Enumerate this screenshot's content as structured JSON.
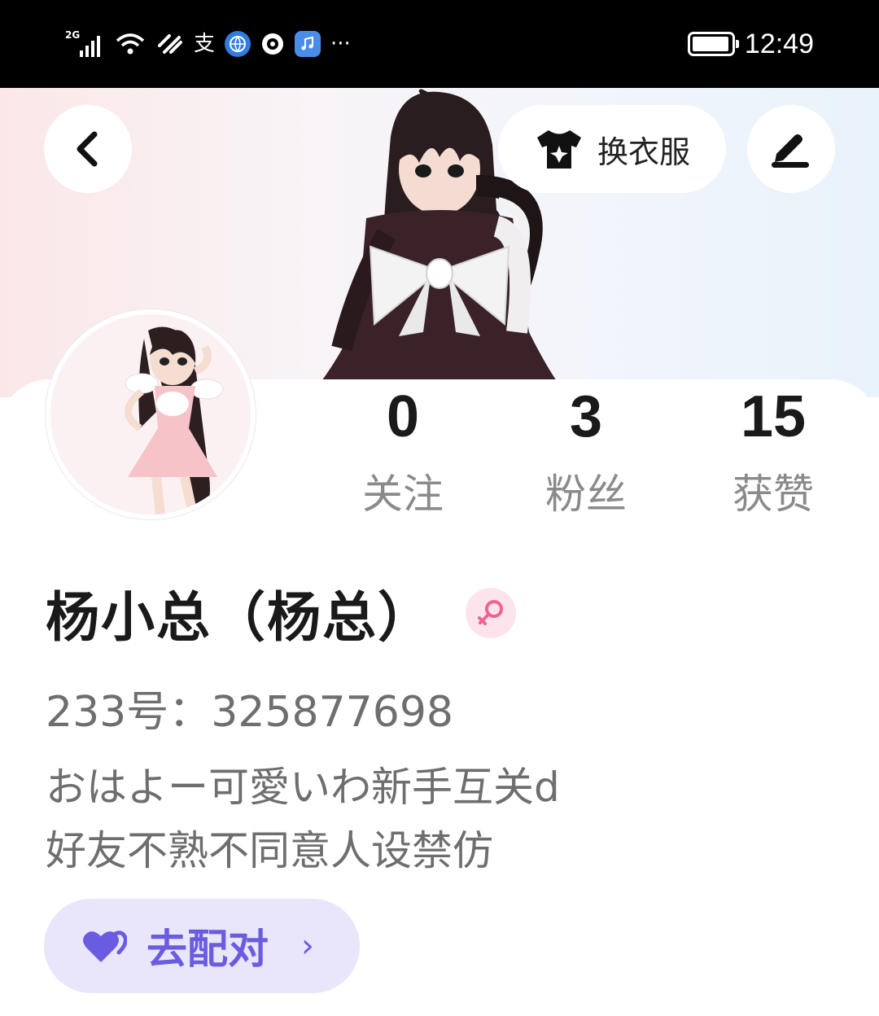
{
  "status_bar": {
    "network": "2G",
    "time": "12:49",
    "battery_level": 0.95,
    "icons": [
      "signal-icon",
      "wifi-icon",
      "app-icon",
      "alipay-icon",
      "browser-icon",
      "camera-app-icon",
      "music-app-icon",
      "more-dots-icon",
      "battery-icon"
    ],
    "more": "···",
    "alipay_glyph": "支"
  },
  "header": {
    "outfit_button_label": "换衣服",
    "back_icon": "chevron-left-icon",
    "edit_icon": "pen-icon",
    "outfit_icon": "tshirt-icon"
  },
  "stats": [
    {
      "value": "0",
      "label": "关注"
    },
    {
      "value": "3",
      "label": "粉丝"
    },
    {
      "value": "15",
      "label": "获赞"
    }
  ],
  "profile": {
    "name": "杨小总（杨总）",
    "gender": "female",
    "gender_icon": "female-symbol-icon",
    "uid": "233号：325877698",
    "bio_line1": "おはよー可愛いわ新手互关d",
    "bio_line2": "好友不熟不同意人设禁仿"
  },
  "match_button": {
    "label": "去配对",
    "icon": "heart-icon",
    "chevron": "›"
  },
  "colors": {
    "accent": "#6a5ce0",
    "match_bg": "#e9e6fb",
    "gender_pink": "#f06292"
  }
}
